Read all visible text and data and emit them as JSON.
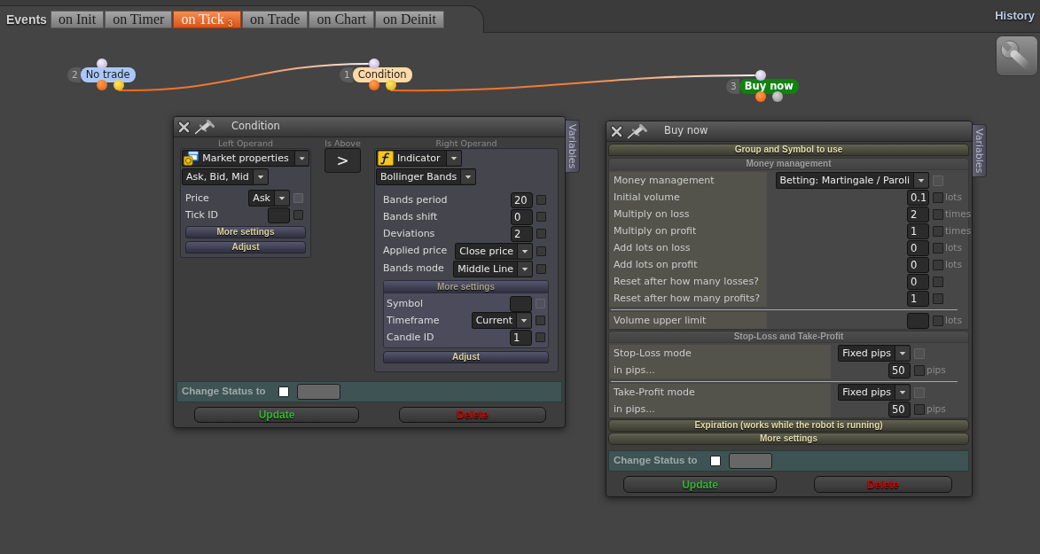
{
  "events_bar": {
    "label": "Events",
    "tabs": [
      {
        "label": "on Init",
        "selected": false
      },
      {
        "label": "on Timer",
        "selected": false
      },
      {
        "label": "on Tick $_{3}$",
        "selected": true
      },
      {
        "label": "on Trade",
        "selected": false
      },
      {
        "label": "on Chart",
        "selected": false
      },
      {
        "label": "on Deinit",
        "selected": false
      }
    ]
  },
  "history": {
    "label": "History"
  },
  "nodes": [
    {
      "number": "2",
      "label": "No trade",
      "color": "#a9c8f8",
      "linked": true
    },
    {
      "number": "1",
      "label": "Condition",
      "color": "#ffdaa8",
      "linked": true
    },
    {
      "number": "3",
      "label": "Buy now",
      "color": "#128112",
      "linked": false
    }
  ],
  "condition_panel": {
    "title": "Condition",
    "side_tab": "Variables",
    "operands": [
      {
        "kind": "market",
        "caption": "Left Operand",
        "source": "Market properties",
        "property": "Ask, Bid, Mid",
        "params": [
          {
            "label": "Price",
            "kind": "select",
            "value": "Ask",
            "checked": false,
            "disabled": true
          },
          {
            "label": "Tick ID",
            "kind": "input",
            "checked": false,
            "disabled": false
          }
        ],
        "more_settings": {
          "label": "More settings",
          "expanded": false
        },
        "adjust": "Adjust"
      },
      {
        "kind": "indicator",
        "caption": "Right Operand",
        "source": "Indicator",
        "property": "Bollinger Bands",
        "params": [
          {
            "label": "Bands period",
            "kind": "input",
            "value": "20",
            "checked": false,
            "disabled": false
          },
          {
            "label": "Bands shift",
            "kind": "input",
            "value": "0",
            "checked": false,
            "disabled": false
          },
          {
            "label": "Deviations",
            "kind": "input",
            "value": "2",
            "checked": false,
            "disabled": false
          },
          {
            "label": "Applied price",
            "kind": "select",
            "value": "Close price",
            "checked": false,
            "disabled": false
          },
          {
            "label": "Bands mode",
            "kind": "select",
            "value": "Middle Line",
            "checked": false,
            "disabled": false
          }
        ],
        "more_settings": {
          "label": "More settings",
          "expanded": true,
          "params": [
            {
              "label": "Symbol",
              "kind": "input",
              "checked": false,
              "disabled": true
            },
            {
              "label": "Timeframe",
              "kind": "select",
              "value": "Current",
              "checked": false,
              "disabled": false
            },
            {
              "label": "Candle ID",
              "kind": "input",
              "value": "1",
              "checked": false,
              "disabled": false
            }
          ]
        },
        "adjust": "Adjust"
      }
    ],
    "operator": {
      "caption": "Is Above",
      "symbol": ">"
    },
    "change_status": {
      "label": "Change Status to",
      "checked": false
    },
    "buttons": [
      {
        "label": "Update",
        "kind": "update"
      },
      {
        "label": "Delete",
        "kind": "delete"
      }
    ]
  },
  "buy_panel": {
    "title": "Buy now",
    "side_tab": "Variables",
    "sections": [
      {
        "title": "Group and Symbol to use",
        "expanded": false
      },
      {
        "title": "Money management",
        "expanded": true,
        "groups": [
          [
            {
              "label": "Money management",
              "kind": "select",
              "value": "Betting: Martingale / Paroli",
              "checked": false,
              "disabled": true
            },
            {
              "label": "Initial volume",
              "kind": "input",
              "value": "0.1",
              "checked": false,
              "disabled": false,
              "unit": "lots"
            },
            {
              "label": "Multiply on loss",
              "kind": "input",
              "value": "2",
              "checked": false,
              "disabled": false,
              "unit": "times"
            },
            {
              "label": "Multiply on profit",
              "kind": "input",
              "value": "1",
              "checked": false,
              "disabled": false,
              "unit": "times"
            },
            {
              "label": "Add lots on loss",
              "kind": "input",
              "value": "0",
              "checked": false,
              "disabled": false,
              "unit": "lots"
            },
            {
              "label": "Add lots on profit",
              "kind": "input",
              "value": "0",
              "checked": false,
              "disabled": false,
              "unit": "lots"
            },
            {
              "label": "Reset after how many losses?",
              "kind": "input",
              "value": "0",
              "checked": false,
              "disabled": false
            },
            {
              "label": "Reset after how many profits?",
              "kind": "input",
              "value": "1",
              "checked": false,
              "disabled": false
            }
          ],
          [
            {
              "label": "Volume upper limit",
              "kind": "input",
              "checked": false,
              "disabled": false,
              "unit": "lots"
            }
          ]
        ]
      },
      {
        "title": "Stop-Loss and Take-Profit",
        "expanded": true,
        "groups": [
          [
            {
              "label": "Stop-Loss mode",
              "kind": "select",
              "value": "Fixed pips",
              "checked": false,
              "disabled": true
            },
            {
              "label": "in pips...",
              "kind": "input",
              "value": "50",
              "checked": false,
              "disabled": false,
              "unit": "pips"
            }
          ],
          [
            {
              "label": "Take-Profit mode",
              "kind": "select",
              "value": "Fixed pips",
              "checked": false,
              "disabled": true
            },
            {
              "label": "in pips...",
              "kind": "input",
              "value": "50",
              "checked": false,
              "disabled": false,
              "unit": "pips"
            }
          ]
        ]
      },
      {
        "title": "Expiration (works while the robot is running)",
        "expanded": false
      },
      {
        "title": "More settings",
        "expanded": false
      }
    ],
    "change_status": {
      "label": "Change Status to",
      "checked": false
    },
    "buttons": [
      {
        "label": "Update",
        "kind": "update"
      },
      {
        "label": "Delete",
        "kind": "delete"
      }
    ]
  }
}
